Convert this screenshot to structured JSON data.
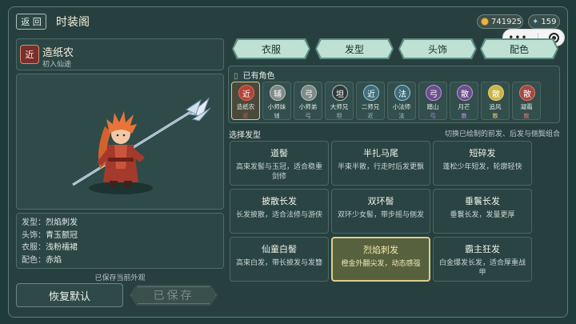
{
  "header": {
    "back_label": "返 回",
    "title": "时装阁",
    "coins": "741925",
    "gems": "159"
  },
  "character": {
    "badge": "近",
    "name": "造纸农",
    "subtitle": "初入仙途"
  },
  "outfit_info": [
    {
      "key": "发型：",
      "value": "烈焰刺发"
    },
    {
      "key": "头饰：",
      "value": "青玉额冠"
    },
    {
      "key": "衣服：",
      "value": "浅粉襦裙"
    },
    {
      "key": "配色：",
      "value": "赤焰"
    }
  ],
  "saved_note": "已保存当前外观",
  "reset_label": "恢复默认",
  "save_label": "已保存",
  "tabs": [
    "衣服",
    "发型",
    "头饰",
    "配色"
  ],
  "roles_title": "已有角色",
  "roles": [
    {
      "badge": "近",
      "name": "造纸农",
      "tag": "近",
      "color": "#b0453a",
      "tagColor": "#e0684f"
    },
    {
      "badge": "辅",
      "name": "小师妹",
      "tag": "辅",
      "color": "#7d8a86",
      "tagColor": "#b8c2bd"
    },
    {
      "badge": "弓",
      "name": "小师弟",
      "tag": "弓",
      "color": "#7d8a86",
      "tagColor": "#b8c2bd"
    },
    {
      "badge": "坦",
      "name": "大师兄",
      "tag": "坦",
      "color": "#2f3a38",
      "tagColor": "#b8c2bd"
    },
    {
      "badge": "近",
      "name": "二师兄",
      "tag": "近",
      "color": "#3c6f7b",
      "tagColor": "#9fc9d6"
    },
    {
      "badge": "法",
      "name": "小法师",
      "tag": "法",
      "color": "#3b6b76",
      "tagColor": "#9fc9d6"
    },
    {
      "badge": "弓",
      "name": "踏山",
      "tag": "弓",
      "color": "#6c4f8a",
      "tagColor": "#b796e0"
    },
    {
      "badge": "散",
      "name": "月芒",
      "tag": "散",
      "color": "#6c4f8a",
      "tagColor": "#b796e0"
    },
    {
      "badge": "散",
      "name": "追风",
      "tag": "散",
      "color": "#c9b54a",
      "tagColor": "#e3d06a"
    },
    {
      "badge": "散",
      "name": "凝霜",
      "tag": "散",
      "color": "#a24a44",
      "tagColor": "#e07a5f"
    }
  ],
  "hair_section_label": "选择发型",
  "hair_section_hint": "切换已绘制的前发、后发与侧鬓组合",
  "hair_styles": [
    {
      "name": "道髻",
      "desc": "高束发髻与玉冠，适合稳重剑修"
    },
    {
      "name": "半扎马尾",
      "desc": "半束半散，行走时后发更飘"
    },
    {
      "name": "短碎发",
      "desc": "蓬松少年短发，轮廓轻快"
    },
    {
      "name": "披散长发",
      "desc": "长发披散，适合法修与游侠"
    },
    {
      "name": "双环髻",
      "desc": "双环少女髻，带步摇与侧发"
    },
    {
      "name": "垂鬟长发",
      "desc": "垂鬟长发，发量更厚"
    },
    {
      "name": "仙童白髻",
      "desc": "高束白发，带长披发与发簪"
    },
    {
      "name": "烈焰刺发",
      "desc": "橙金外翻尖发，动态感强"
    },
    {
      "name": "霸主狂发",
      "desc": "白金爆发长发，适合厚重战甲"
    }
  ],
  "selected_hair": 7
}
